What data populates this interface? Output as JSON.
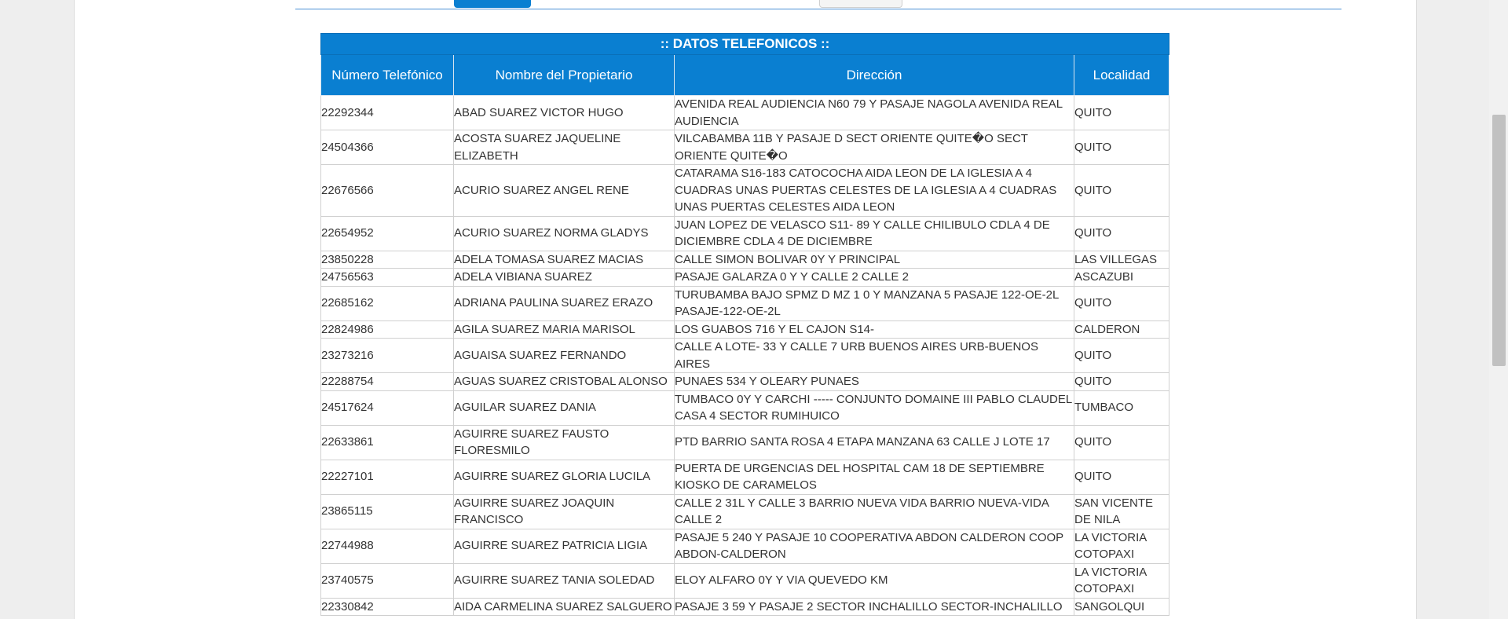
{
  "table": {
    "title": ":: DATOS TELEFONICOS ::",
    "headers": [
      "Número Telefónico",
      "Nombre del Propietario",
      "Dirección",
      "Localidad"
    ],
    "rows": [
      [
        "22292344",
        "ABAD SUAREZ VICTOR HUGO",
        "AVENIDA REAL AUDIENCIA N60 79 Y PASAJE NAGOLA AVENIDA REAL AUDIENCIA",
        "QUITO"
      ],
      [
        "24504366",
        "ACOSTA SUAREZ JAQUELINE ELIZABETH",
        "VILCABAMBA 11B Y PASAJE D SECT ORIENTE QUITE�O SECT ORIENTE QUITE�O",
        "QUITO"
      ],
      [
        "22676566",
        "ACURIO SUAREZ ANGEL RENE",
        "CATARAMA S16-183 CATOCOCHA AIDA LEON DE LA IGLESIA A 4 CUADRAS UNAS PUERTAS CELESTES DE LA IGLESIA A 4 CUADRAS UNAS PUERTAS CELESTES AIDA LEON",
        "QUITO"
      ],
      [
        "22654952",
        "ACURIO SUAREZ NORMA GLADYS",
        "JUAN LOPEZ DE VELASCO S11- 89 Y CALLE CHILIBULO CDLA 4 DE DICIEMBRE CDLA 4 DE DICIEMBRE",
        "QUITO"
      ],
      [
        "23850228",
        "ADELA TOMASA SUAREZ MACIAS",
        "CALLE SIMON BOLIVAR 0Y Y PRINCIPAL",
        "LAS VILLEGAS"
      ],
      [
        "24756563",
        "ADELA VIBIANA SUAREZ",
        "PASAJE GALARZA 0 Y Y CALLE 2 CALLE 2",
        "ASCAZUBI"
      ],
      [
        "22685162",
        "ADRIANA PAULINA SUAREZ ERAZO",
        "TURUBAMBA BAJO SPMZ D MZ 1 0 Y MANZANA 5 PASAJE 122-OE-2L PASAJE-122-OE-2L",
        "QUITO"
      ],
      [
        "22824986",
        "AGILA SUAREZ MARIA MARISOL",
        "LOS GUABOS 716 Y EL CAJON S14-",
        "CALDERON"
      ],
      [
        "23273216",
        "AGUAISA SUAREZ FERNANDO",
        "CALLE A LOTE- 33 Y CALLE 7 URB BUENOS AIRES URB-BUENOS AIRES",
        "QUITO"
      ],
      [
        "22288754",
        "AGUAS SUAREZ CRISTOBAL ALONSO",
        "PUNAES 534 Y OLEARY PUNAES",
        "QUITO"
      ],
      [
        "24517624",
        "AGUILAR SUAREZ DANIA",
        "TUMBACO 0Y Y CARCHI ----- CONJUNTO DOMAINE III PABLO CLAUDEL CASA 4 SECTOR RUMIHUICO",
        "TUMBACO"
      ],
      [
        "22633861",
        "AGUIRRE SUAREZ FAUSTO FLORESMILO",
        "PTD BARRIO SANTA ROSA 4 ETAPA MANZANA 63 CALLE J LOTE 17",
        "QUITO"
      ],
      [
        "22227101",
        "AGUIRRE SUAREZ GLORIA LUCILA",
        "PUERTA DE URGENCIAS DEL HOSPITAL CAM 18 DE SEPTIEMBRE KIOSKO DE CARAMELOS",
        "QUITO"
      ],
      [
        "23865115",
        "AGUIRRE SUAREZ JOAQUIN FRANCISCO",
        "CALLE 2 31L Y CALLE 3 BARRIO NUEVA VIDA BARRIO NUEVA-VIDA CALLE 2",
        "SAN VICENTE DE NILA"
      ],
      [
        "22744988",
        "AGUIRRE SUAREZ PATRICIA LIGIA",
        "PASAJE 5 240 Y PASAJE 10 COOPERATIVA ABDON CALDERON COOP ABDON-CALDERON",
        "LA VICTORIA COTOPAXI"
      ],
      [
        "23740575",
        "AGUIRRE SUAREZ TANIA SOLEDAD",
        "ELOY ALFARO 0Y Y VIA QUEVEDO KM",
        "LA VICTORIA COTOPAXI"
      ],
      [
        "22330842",
        "AIDA CARMELINA SUAREZ SALGUERO",
        "PASAJE 3 59 Y PASAJE 2 SECTOR INCHALILLO SECTOR-INCHALILLO",
        "SANGOLQUI"
      ]
    ]
  }
}
